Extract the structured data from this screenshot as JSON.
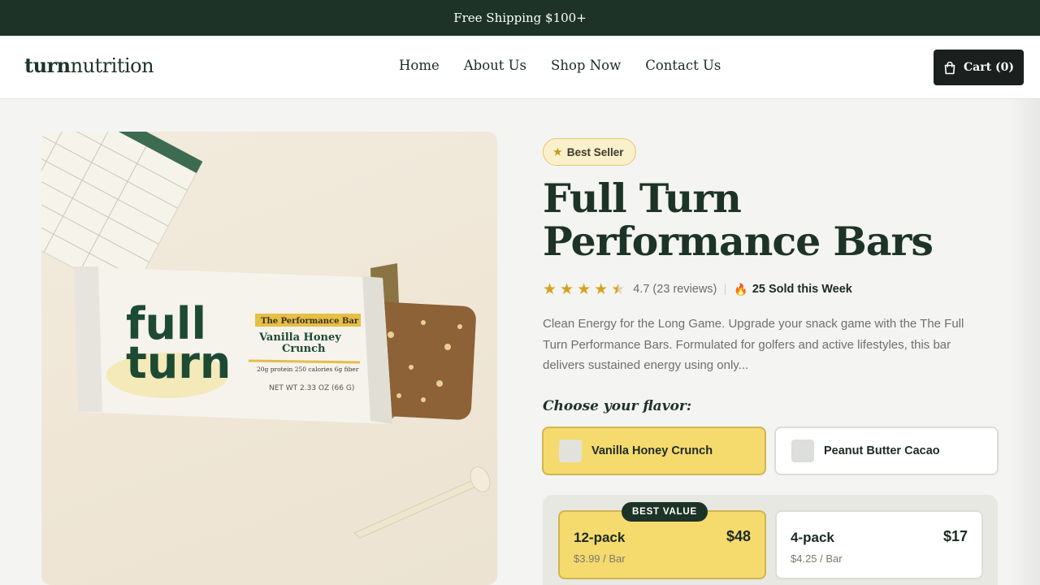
{
  "announcement": "Free Shipping $100+",
  "header": {
    "logo_bold": "turn",
    "logo_rest": "nutrition",
    "nav": [
      "Home",
      "About Us",
      "Shop Now",
      "Contact Us"
    ],
    "cart_label": "Cart (0)"
  },
  "product": {
    "badge": "Best Seller",
    "title": "Full Turn Performance Bars",
    "rating_text": "4.7 (23 reviews)",
    "rating_value": 4.7,
    "sold_text": "25 Sold this Week",
    "description": "Clean Energy for the Long Game. Upgrade your snack game with the The Full Turn Performance Bars. Formulated for golfers and active lifestyles, this bar delivers sustained energy using only...",
    "choose_label": "Choose your flavor:",
    "flavors": [
      {
        "label": "Vanilla Honey Crunch",
        "selected": true
      },
      {
        "label": "Peanut Butter Cacao",
        "selected": false
      }
    ],
    "packs": [
      {
        "name": "12-pack",
        "price": "$48",
        "per": "$3.99 / Bar",
        "tag": "BEST VALUE",
        "selected": true
      },
      {
        "name": "4-pack",
        "price": "$17",
        "per": "$4.25 / Bar",
        "selected": false
      }
    ]
  },
  "image": {
    "wrapper_brand_1": "full",
    "wrapper_brand_2": "turn",
    "wrapper_tag": "The Performance Bar",
    "wrapper_flavor_1": "Vanilla Honey",
    "wrapper_flavor_2": "Crunch",
    "wrapper_stats": "20g protein   250 calories   6g fiber",
    "wrapper_weight": "NET WT 2.33 OZ (66 G)"
  },
  "colors": {
    "announce_bg": "#1d3328",
    "accent_yellow": "#f5da6e",
    "brand_green": "#1d3328",
    "star": "#d6a21e"
  }
}
